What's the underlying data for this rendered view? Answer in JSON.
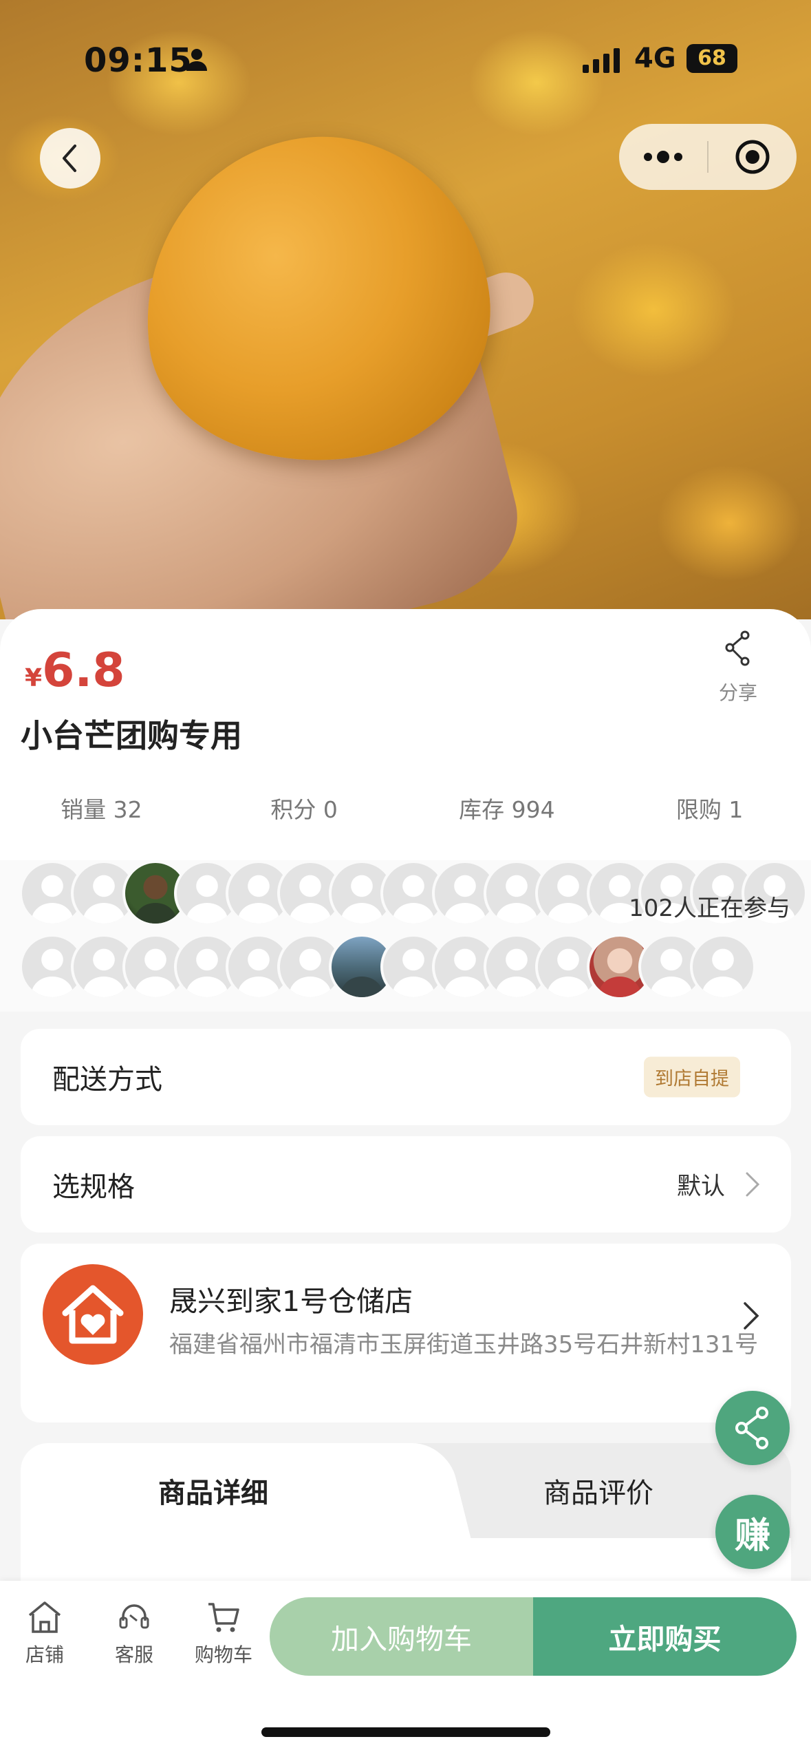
{
  "status_bar": {
    "time": "09:15",
    "network": "4G",
    "battery": "68"
  },
  "product": {
    "currency": "¥",
    "price": "6.8",
    "title": "小台芒团购专用",
    "share_label": "分享",
    "stats": [
      "销量 32",
      "积分 0",
      "库存 994",
      "限购 1"
    ]
  },
  "participants": {
    "count_text": "102人正在参与"
  },
  "delivery": {
    "label": "配送方式",
    "value": "到店自提"
  },
  "spec": {
    "label": "选规格",
    "value": "默认"
  },
  "store": {
    "name": "晟兴到家1号仓储店",
    "address": "福建省福州市福清市玉屏街道玉井路35号石井新村131号"
  },
  "tabs": [
    {
      "label": "商品详细"
    },
    {
      "label": "商品评价"
    }
  ],
  "floating": {
    "earn_label": "赚"
  },
  "bottom_bar": {
    "items": [
      {
        "label": "店铺"
      },
      {
        "label": "客服"
      },
      {
        "label": "购物车"
      }
    ],
    "add_to_cart": "加入购物车",
    "buy_now": "立即购买"
  },
  "colors": {
    "price": "#d4443b",
    "accent_green": "#4ea780",
    "light_green": "#a8d0aa",
    "store_logo": "#e4562c"
  }
}
